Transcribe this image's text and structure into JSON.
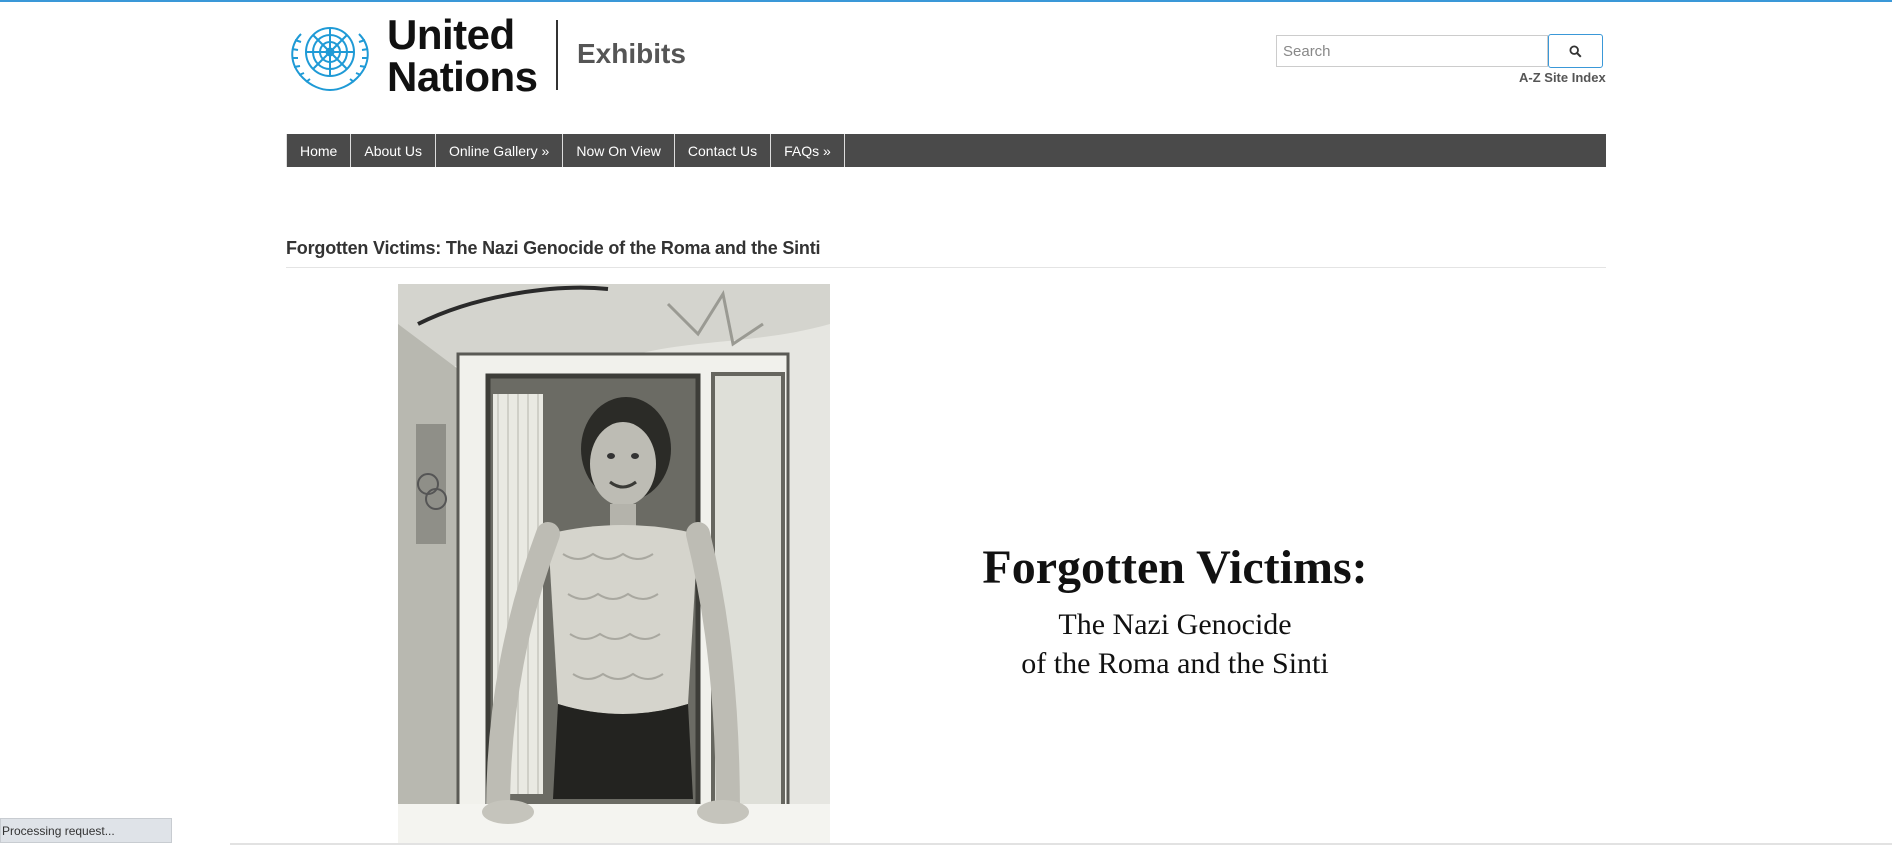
{
  "brand": {
    "line1": "United",
    "line2": "Nations",
    "site_name": "Exhibits"
  },
  "search": {
    "placeholder": "Search",
    "button_icon": "search-icon",
    "az_index": "A-Z Site Index"
  },
  "nav": {
    "items": [
      {
        "label": "Home"
      },
      {
        "label": "About Us"
      },
      {
        "label": "Online Gallery »"
      },
      {
        "label": "Now On View"
      },
      {
        "label": "Contact Us"
      },
      {
        "label": "FAQs »"
      }
    ],
    "background": "#4a4a4a"
  },
  "page": {
    "title": "Forgotten Victims: The Nazi Genocide of the Roma and the Sinti"
  },
  "poster": {
    "title": "Forgotten Victims:",
    "subtitle_line1": "The Nazi Genocide",
    "subtitle_line2": "of the Roma and the Sinti"
  },
  "status_bar": {
    "text": "Processing request..."
  },
  "colors": {
    "accent": "#3a98d8",
    "un_blue": "#1f9ad6"
  }
}
